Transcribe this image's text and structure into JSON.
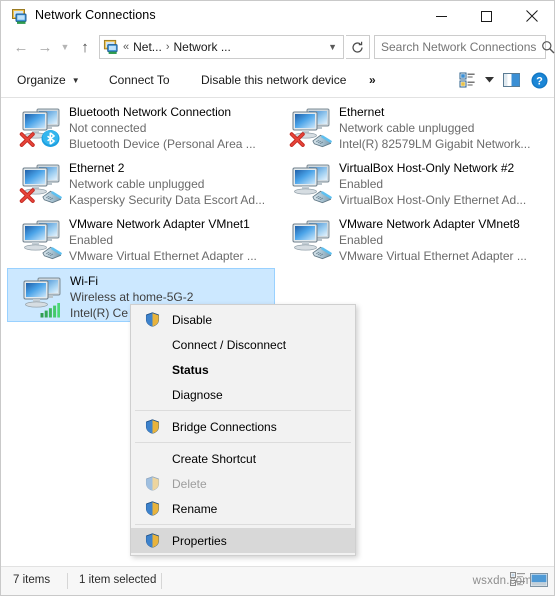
{
  "window": {
    "title": "Network Connections",
    "icon": "network-connections-icon",
    "minimize_label": "minimize-icon",
    "maximize_label": "maximize-icon",
    "close_label": "close-icon"
  },
  "navigation": {
    "back_icon": "back-arrow-icon",
    "forward_icon": "forward-arrow-icon",
    "recent_icon": "recent-locations-chevron-icon",
    "up_icon": "up-arrow-icon",
    "breadcrumb_overflow": "«",
    "crumb1": "Net...",
    "crumb_sep": "›",
    "crumb2": "Network ...",
    "dropdown_icon": "chevron-down-icon",
    "refresh_icon": "refresh-icon"
  },
  "search": {
    "placeholder": "Search Network Connections",
    "value": "",
    "icon": "search-icon"
  },
  "toolbar": {
    "organize": "Organize",
    "connect_to": "Connect To",
    "disable_device": "Disable this network device",
    "overflow": "»",
    "view_icon": "change-view-icon",
    "view_caret_icon": "chevron-down-icon",
    "preview_pane_icon": "preview-pane-icon",
    "help_icon": "help-icon"
  },
  "connections": [
    {
      "name": "Bluetooth Network Connection",
      "status": "Not connected",
      "device": "Bluetooth Device (Personal Area ...",
      "icon": "network-adapter-icon",
      "badge": "bluetooth-badge-icon",
      "error": true,
      "selected": false
    },
    {
      "name": "Ethernet",
      "status": "Network cable unplugged",
      "device": "Intel(R) 82579LM Gigabit Network...",
      "icon": "network-adapter-icon",
      "badge": "rj45-badge-icon",
      "error": true,
      "selected": false
    },
    {
      "name": "Ethernet 2",
      "status": "Network cable unplugged",
      "device": "Kaspersky Security Data Escort Ad...",
      "icon": "network-adapter-icon",
      "badge": "rj45-badge-icon",
      "error": true,
      "selected": false
    },
    {
      "name": "VirtualBox Host-Only Network #2",
      "status": "Enabled",
      "device": "VirtualBox Host-Only Ethernet Ad...",
      "icon": "network-adapter-icon",
      "badge": "rj45-badge-icon",
      "error": false,
      "selected": false
    },
    {
      "name": "VMware Network Adapter VMnet1",
      "status": "Enabled",
      "device": "VMware Virtual Ethernet Adapter ...",
      "icon": "network-adapter-icon",
      "badge": "rj45-badge-icon",
      "error": false,
      "selected": false
    },
    {
      "name": "VMware Network Adapter VMnet8",
      "status": "Enabled",
      "device": "VMware Virtual Ethernet Adapter ...",
      "icon": "network-adapter-icon",
      "badge": "rj45-badge-icon",
      "error": false,
      "selected": false
    },
    {
      "name": "Wi-Fi",
      "status": "Wireless at home-5G-2",
      "device": "Intel(R) Ce",
      "icon": "network-adapter-icon",
      "badge": "wifi-signal-badge-icon",
      "error": false,
      "selected": true
    }
  ],
  "context_menu": {
    "items": [
      {
        "label": "Disable",
        "shield": true,
        "bold": false,
        "disabled": false,
        "highlighted": false,
        "separator_after": false
      },
      {
        "label": "Connect / Disconnect",
        "shield": false,
        "bold": false,
        "disabled": false,
        "highlighted": false,
        "separator_after": false
      },
      {
        "label": "Status",
        "shield": false,
        "bold": true,
        "disabled": false,
        "highlighted": false,
        "separator_after": false
      },
      {
        "label": "Diagnose",
        "shield": false,
        "bold": false,
        "disabled": false,
        "highlighted": false,
        "separator_after": true
      },
      {
        "label": "Bridge Connections",
        "shield": true,
        "bold": false,
        "disabled": false,
        "highlighted": false,
        "separator_after": true
      },
      {
        "label": "Create Shortcut",
        "shield": false,
        "bold": false,
        "disabled": false,
        "highlighted": false,
        "separator_after": false
      },
      {
        "label": "Delete",
        "shield": true,
        "bold": false,
        "disabled": true,
        "highlighted": false,
        "separator_after": false
      },
      {
        "label": "Rename",
        "shield": true,
        "bold": false,
        "disabled": false,
        "highlighted": false,
        "separator_after": true
      },
      {
        "label": "Properties",
        "shield": true,
        "bold": false,
        "disabled": false,
        "highlighted": true,
        "separator_after": false
      }
    ]
  },
  "statusbar": {
    "item_count": "7 items",
    "selection": "1 item selected",
    "watermark": "wsxdn.com",
    "details_view_icon": "details-view-icon",
    "large_icons_view_icon": "large-icons-view-icon"
  },
  "colors": {
    "selection_fill": "#cce8ff",
    "selection_border": "#99d1ff",
    "menu_bg": "#f2f2f2",
    "menu_highlight": "#d8d8d8",
    "accent_blue": "#0078d7",
    "error_red": "#cc2b2b",
    "close_hover": "#e81123"
  }
}
